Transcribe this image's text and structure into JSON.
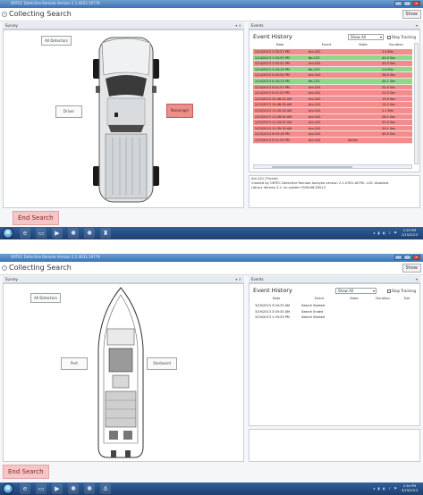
{
  "screens": [
    {
      "app_title": "ORTEC Detective Remote Version 2.1.4633.19779",
      "screen_title": "Collecting Search",
      "show_button": "Show",
      "survey_header": "Survey",
      "events_header": "Events",
      "buttons": {
        "all_detectors": "All Detectors",
        "left_side": "Driver",
        "right_side": "Passenger",
        "end_search": "End Search"
      },
      "right_side_active": true,
      "vehicle_icon": "car-top-view-icon",
      "event_history": {
        "title": "Event History",
        "filter_value": "Show All",
        "stop_tracking_label": "Stop Tracking",
        "columns": [
          "Date",
          "Event",
          "State",
          "Duration"
        ],
        "rows": [
          {
            "date": "2/14/2013 1:30:27 PM",
            "event": "Am-241",
            "state": "",
            "duration": "1.4 Min",
            "color": "red"
          },
          {
            "date": "2/14/2013 1:30:53 PM",
            "event": "Ba-133",
            "state": "",
            "duration": "40.0 Sec",
            "color": "green"
          },
          {
            "date": "2/14/2013 1:32:51 PM",
            "event": "Am-241",
            "state": "",
            "duration": "43.5 Sec",
            "color": "red"
          },
          {
            "date": "2/14/2013 1:34:19 PM",
            "event": "Ba-133",
            "state": "",
            "duration": "2.8 Min",
            "color": "green"
          },
          {
            "date": "2/14/2013 3:20:54 PM",
            "event": "Am-241",
            "state": "",
            "duration": "36.0 Sec",
            "color": "red"
          },
          {
            "date": "2/14/2013 5:34:15 PM",
            "event": "Ba-133",
            "state": "",
            "duration": "44.1 Sec",
            "color": "green"
          },
          {
            "date": "2/14/2013 5:41:07 PM",
            "event": "Am-241",
            "state": "",
            "duration": "22.0 Sec",
            "color": "red"
          },
          {
            "date": "2/14/2013 5:41:20 PM",
            "event": "Am-241",
            "state": "",
            "duration": "22.0 Sec",
            "color": "red"
          },
          {
            "date": "2/15/2013 10:46:20 AM",
            "event": "Am-241",
            "state": "",
            "duration": "13.9 Sec",
            "color": "red"
          },
          {
            "date": "2/15/2013 10:48:36 AM",
            "event": "Am-241",
            "state": "",
            "duration": "14.2 Sec",
            "color": "red"
          },
          {
            "date": "2/15/2013 11:20:18 AM",
            "event": "Am-241",
            "state": "",
            "duration": "1.1 Min",
            "color": "red"
          },
          {
            "date": "2/15/2013 11:26:04 AM",
            "event": "Am-241",
            "state": "",
            "duration": "28.1 Sec",
            "color": "red"
          },
          {
            "date": "2/15/2013 11:29:51 AM",
            "event": "Am-241",
            "state": "",
            "duration": "32.0 Sec",
            "color": "red"
          },
          {
            "date": "2/15/2013 11:30:29 AM",
            "event": "Am-241",
            "state": "",
            "duration": "29.1 Sec",
            "color": "red"
          },
          {
            "date": "2/15/2013 9:03:18 PM",
            "event": "Am-241",
            "state": "",
            "duration": "49.5 Sec",
            "color": "red"
          },
          {
            "date": "2/15/2013 9:11:05 PM",
            "event": "Am-241",
            "state": "Active",
            "duration": "",
            "color": "red"
          }
        ]
      },
      "info_lines": [
        "Am-241 (Threat)",
        "Created by ORTEC Detective Remote Analysis version 2.1.4783.18790. LCK: disabled.",
        "Library Version 2.2. on system FUMLAB-DELL2"
      ],
      "taskbar": {
        "clock_time": "1:29 PM",
        "clock_date": "2/15/2013"
      }
    },
    {
      "app_title": "ORTEC Detective Remote Version 2.1.4633.19779",
      "screen_title": "Collecting Search",
      "show_button": "Show",
      "survey_header": "Survey",
      "events_header": "Events",
      "buttons": {
        "all_detectors": "All Detectors",
        "left_side": "Port",
        "right_side": "Starboard",
        "end_search": "End Search"
      },
      "right_side_active": false,
      "vehicle_icon": "boat-top-view-icon",
      "event_history": {
        "title": "Event History",
        "filter_value": "Show All",
        "stop_tracking_label": "Stop Tracking",
        "columns": [
          "Date",
          "Event",
          "State",
          "Duration",
          "Det"
        ],
        "rows": [
          {
            "date": "3/19/2013 3:04:33 AM",
            "event": "Search Started",
            "state": "",
            "duration": "",
            "color": "plain"
          },
          {
            "date": "3/19/2013 3:05:30 AM",
            "event": "Search Ended",
            "state": "",
            "duration": "",
            "color": "plain"
          },
          {
            "date": "3/19/2013 1:33:29 PM",
            "event": "Search Started",
            "state": "",
            "duration": "",
            "color": "plain"
          }
        ]
      },
      "info_lines": [],
      "taskbar": {
        "clock_time": "1:34 PM",
        "clock_date": "3/19/2013"
      }
    }
  ]
}
